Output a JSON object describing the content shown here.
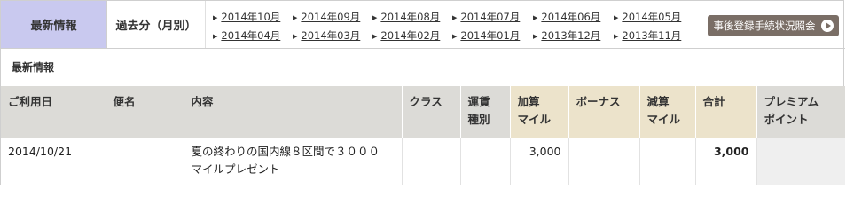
{
  "nav": {
    "latest_tab": "最新情報",
    "past_tab": "過去分（月別）",
    "months_row1": [
      "2014年10月",
      "2014年09月",
      "2014年08月",
      "2014年07月",
      "2014年06月",
      "2014年05月"
    ],
    "months_row2": [
      "2014年04月",
      "2014年03月",
      "2014年02月",
      "2014年01月",
      "2013年12月",
      "2013年11月"
    ],
    "status_button": "事後登録手続状況照会"
  },
  "section_title": "最新情報",
  "table": {
    "headers": {
      "date": "ご利用日",
      "flight": "便名",
      "content": "内容",
      "class": "クラス",
      "fare_type": [
        "運賃",
        "種別"
      ],
      "added_miles": [
        "加算",
        "マイル"
      ],
      "bonus": "ボーナス",
      "deducted_miles": [
        "減算",
        "マイル"
      ],
      "total": "合計",
      "premium_points": [
        "プレミアム",
        "ポイント"
      ]
    },
    "rows": [
      {
        "date": "2014/10/21",
        "flight": "",
        "content": [
          "夏の終わりの国内線８区間で３０００",
          "マイルプレゼント"
        ],
        "class": "",
        "fare_type": "",
        "added_miles": "3,000",
        "bonus": "",
        "deducted_miles": "",
        "total": "3,000",
        "premium_points": ""
      }
    ]
  }
}
